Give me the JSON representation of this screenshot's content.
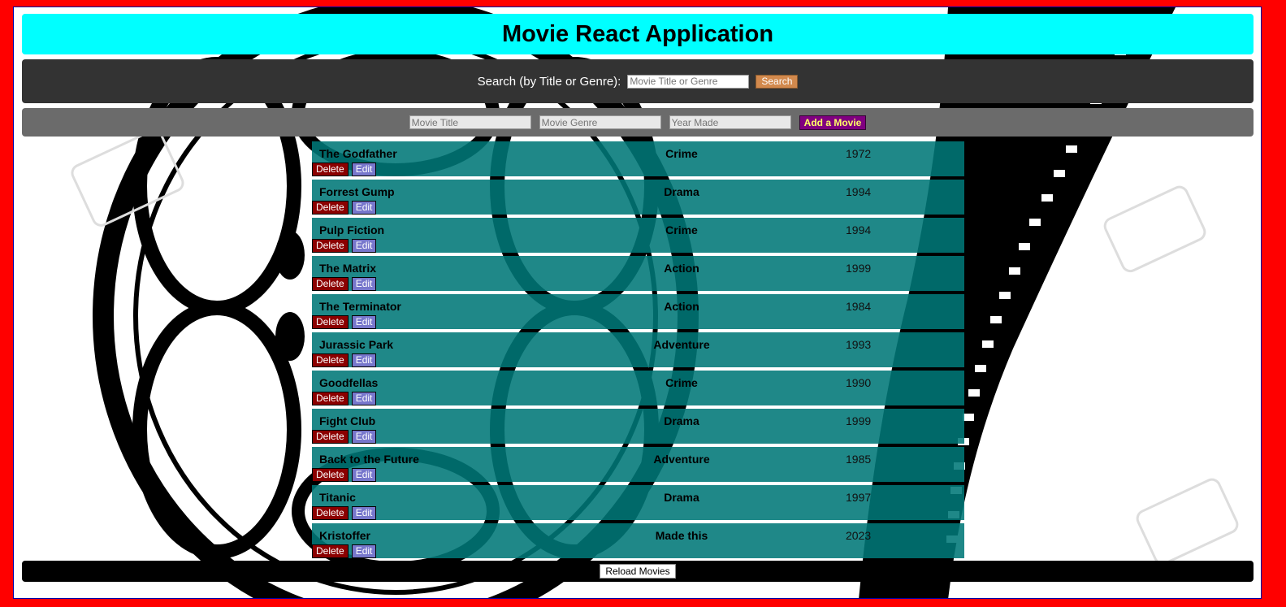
{
  "header": {
    "title": "Movie React Application"
  },
  "search": {
    "label": "Search (by Title or Genre):",
    "placeholder": "Movie Title or Genre",
    "button_label": "Search"
  },
  "add_form": {
    "title_placeholder": "Movie Title",
    "genre_placeholder": "Movie Genre",
    "year_placeholder": "Year Made",
    "button_label": "Add a Movie"
  },
  "movies": [
    {
      "title": "The Godfather",
      "genre": "Crime",
      "year": "1972"
    },
    {
      "title": "Forrest Gump",
      "genre": "Drama",
      "year": "1994"
    },
    {
      "title": "Pulp Fiction",
      "genre": "Crime",
      "year": "1994"
    },
    {
      "title": "The Matrix",
      "genre": "Action",
      "year": "1999"
    },
    {
      "title": "The Terminator",
      "genre": "Action",
      "year": "1984"
    },
    {
      "title": "Jurassic Park",
      "genre": "Adventure",
      "year": "1993"
    },
    {
      "title": "Goodfellas",
      "genre": "Crime",
      "year": "1990"
    },
    {
      "title": "Fight Club",
      "genre": "Drama",
      "year": "1999"
    },
    {
      "title": "Back to the Future",
      "genre": "Adventure",
      "year": "1985"
    },
    {
      "title": "Titanic",
      "genre": "Drama",
      "year": "1997"
    },
    {
      "title": "Kristoffer",
      "genre": "Made this",
      "year": "2023"
    }
  ],
  "row_actions": {
    "delete_label": "Delete",
    "edit_label": "Edit"
  },
  "footer": {
    "reload_label": "Reload Movies"
  },
  "colors": {
    "page_border": "#ff0000",
    "header_bg": "#00ffff",
    "search_bar_bg": "#333333",
    "add_bar_bg": "#6b6b6b",
    "row_bg": "#007878",
    "delete_bg": "#8b0000",
    "edit_bg": "#7777cc",
    "add_button_bg": "#800080",
    "search_button_bg": "#d2894d"
  }
}
